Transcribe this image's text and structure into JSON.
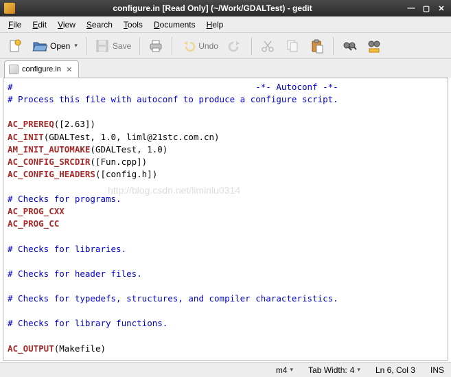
{
  "window": {
    "title": "configure.in [Read Only] (~/Work/GDALTest) - gedit"
  },
  "menu": {
    "file": "File",
    "edit": "Edit",
    "view": "View",
    "search": "Search",
    "tools": "Tools",
    "documents": "Documents",
    "help": "Help"
  },
  "toolbar": {
    "open": "Open",
    "save": "Save",
    "undo": "Undo"
  },
  "tab": {
    "name": "configure.in"
  },
  "code": {
    "l1a": "#",
    "l1b": "-*- Autoconf -*-",
    "l2": "# Process this file with autoconf to produce a configure script.",
    "l4k": "AC_PREREQ",
    "l4t": "([2.63])",
    "l5k": "AC_INIT",
    "l5t": "(GDALTest, 1.0, liml@21stc.com.cn)",
    "l6k": "AM_INIT_AUTOMAKE",
    "l6t": "(GDALTest, 1.0)",
    "l7k": "AC_CONFIG_SRCDIR",
    "l7t": "([Fun.cpp])",
    "l8k": "AC_CONFIG_HEADERS",
    "l8t": "([config.h])",
    "l10": "# Checks for programs.",
    "l11k": "AC_PROG_CXX",
    "l12k": "AC_PROG_CC",
    "l14": "# Checks for libraries.",
    "l16": "# Checks for header files.",
    "l18": "# Checks for typedefs, structures, and compiler characteristics.",
    "l20": "# Checks for library functions.",
    "l22k": "AC_OUTPUT",
    "l22t": "(Makefile)"
  },
  "watermark": "http://blog.csdn.net/liminlu0314",
  "status": {
    "lang": "m4",
    "tabwidth_label": "Tab Width:",
    "tabwidth_value": "4",
    "cursor": "Ln 6, Col 3",
    "mode": "INS"
  }
}
